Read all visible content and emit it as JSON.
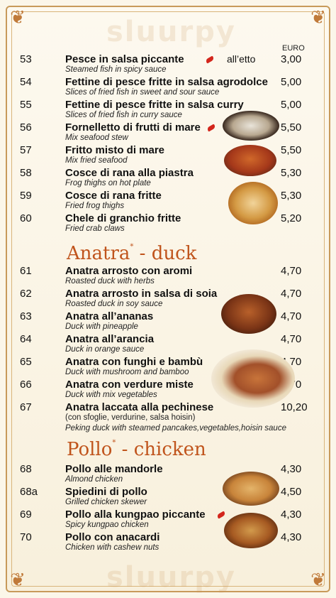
{
  "header": {
    "currency": "EURO",
    "watermark": "sluurpy"
  },
  "items_fish": [
    {
      "num": "53",
      "name": "Pesce in salsa piccante",
      "sub": "Steamed fish in spicy sauce",
      "note": "all’etto",
      "price": "3,00"
    },
    {
      "num": "54",
      "name": "Fettine di pesce fritte in salsa agrodolce",
      "sub": "Slices of fried fish in sweet and sour sauce",
      "price": "5,00"
    },
    {
      "num": "55",
      "name": "Fettine di pesce fritte in salsa curry",
      "sub": "Slices of fried fish in curry sauce",
      "price": "5,00"
    },
    {
      "num": "56",
      "name": "Fornelletto di frutti di mare",
      "sub": "Mix seafood stew",
      "price": "5,50"
    },
    {
      "num": "57",
      "name": "Fritto misto di mare",
      "sub": "Mix fried seafood",
      "price": "5,50"
    },
    {
      "num": "58",
      "name": "Cosce di rana alla piastra",
      "sub": "Frog thighs on hot plate",
      "price": "5,30"
    },
    {
      "num": "59",
      "name": "Cosce di rana fritte",
      "sub": "Fried frog thighs",
      "price": "5,30"
    },
    {
      "num": "60",
      "name": "Chele di granchio fritte",
      "sub": "Fried crab claws",
      "price": "5,20"
    }
  ],
  "section_duck": {
    "name": "Anatra",
    "star": "*",
    "dash": "- duck"
  },
  "items_duck": [
    {
      "num": "61",
      "name": "Anatra arrosto con aromi",
      "sub": "Roasted duck with herbs",
      "price": "4,70"
    },
    {
      "num": "62",
      "name": "Anatra arrosto in salsa di soia",
      "sub": "Roasted duck in soy sauce",
      "price": "4,70"
    },
    {
      "num": "63",
      "name": "Anatra all’ananas",
      "sub": "Duck with pineapple",
      "price": "4,70"
    },
    {
      "num": "64",
      "name": "Anatra all’arancia",
      "sub": "Duck in orange sauce",
      "price": "4,70"
    },
    {
      "num": "65",
      "name": "Anatra con funghi e bambù",
      "sub": "Duck with mushroom and bamboo",
      "price": "4,70"
    },
    {
      "num": "66",
      "name": "Anatra con verdure miste",
      "sub": "Duck with mix vegetables",
      "price": "4,70"
    },
    {
      "num": "67",
      "name": "Anatra laccata alla pechinese",
      "sub_plain": "(con sfoglie, verdurine, salsa hoisin)",
      "sub": "Peking duck with steamed pancakes,vegetables,hoisin sauce",
      "price": "10,20"
    }
  ],
  "section_chicken": {
    "name": "Pollo",
    "star": "*",
    "dash": "- chicken"
  },
  "items_chicken": [
    {
      "num": "68",
      "name": "Pollo alle mandorle",
      "sub": "Almond chicken",
      "price": "4,30"
    },
    {
      "num": "68a",
      "name": "Spiedini di pollo",
      "sub": "Grilled chicken skewer",
      "price": "4,50"
    },
    {
      "num": "69",
      "name": "Pollo alla kungpao piccante",
      "sub": "Spicy kungpao chicken",
      "price": "4,30"
    },
    {
      "num": "70",
      "name": "Pollo con anacardi",
      "sub": "Chicken with cashew nuts",
      "price": "4,30"
    }
  ]
}
